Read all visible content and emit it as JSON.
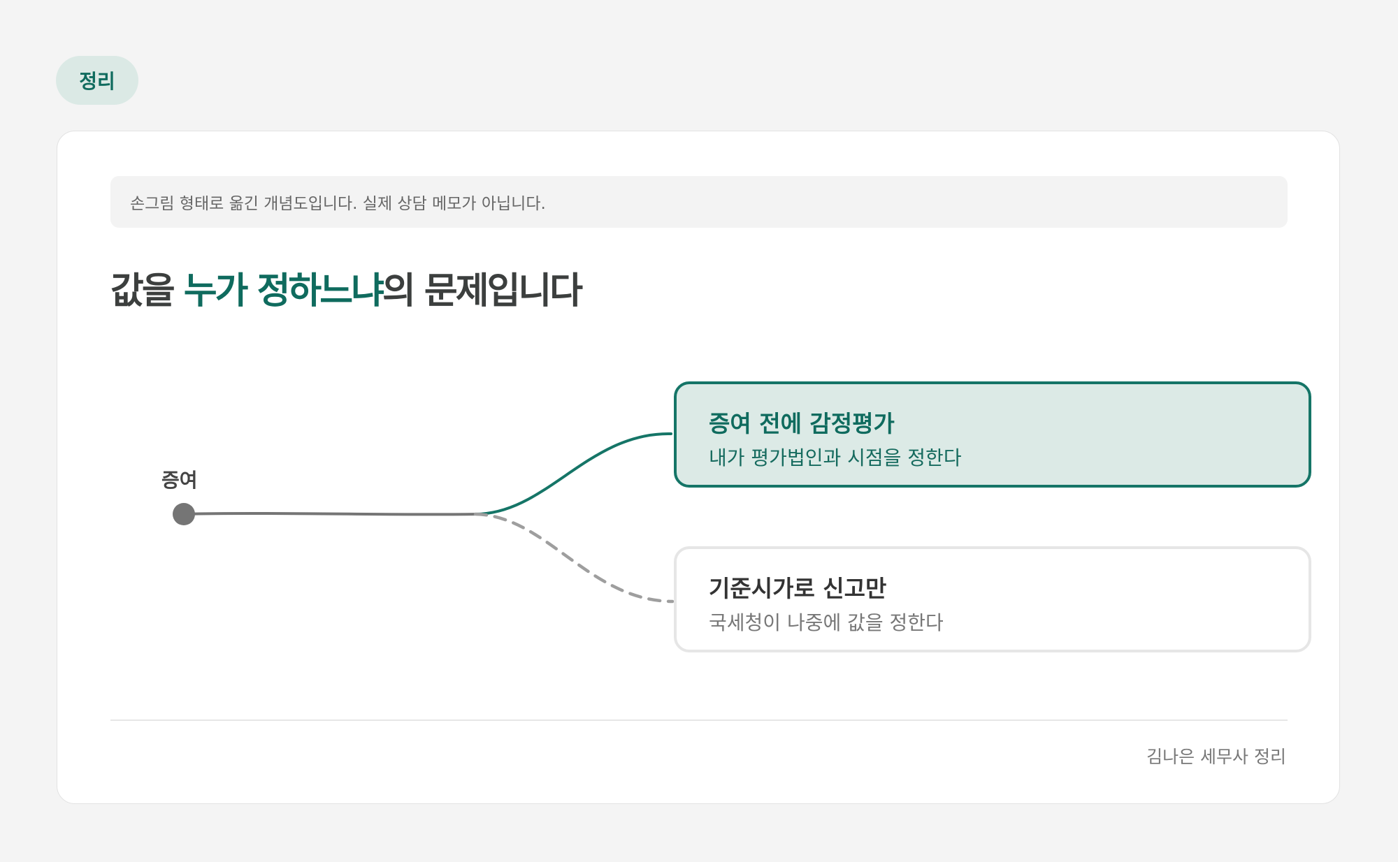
{
  "tag": {
    "label": "정리"
  },
  "notice": {
    "text": "손그림 형태로 옮긴 개념도입니다. 실제 상담 메모가 아닙니다."
  },
  "title": {
    "part1": "값을 ",
    "highlight": "누가 정하느냐",
    "part2": "의 문제입니다"
  },
  "diagram": {
    "origin": {
      "label": "증여"
    },
    "branches": [
      {
        "title": "증여 전에 감정평가",
        "subtitle": "내가 평가법인과 시점을 정한다",
        "style": "primary"
      },
      {
        "title": "기준시가로 신고만",
        "subtitle": "국세청이 나중에 값을 정한다",
        "style": "dashed"
      }
    ]
  },
  "footer": {
    "text": "김나은 세무사 정리"
  },
  "colors": {
    "accent": "#0f6b5e",
    "accent_border": "#157567",
    "accent_fill": "#dceae6",
    "node": "#757575",
    "dashed": "#9e9e9e"
  }
}
